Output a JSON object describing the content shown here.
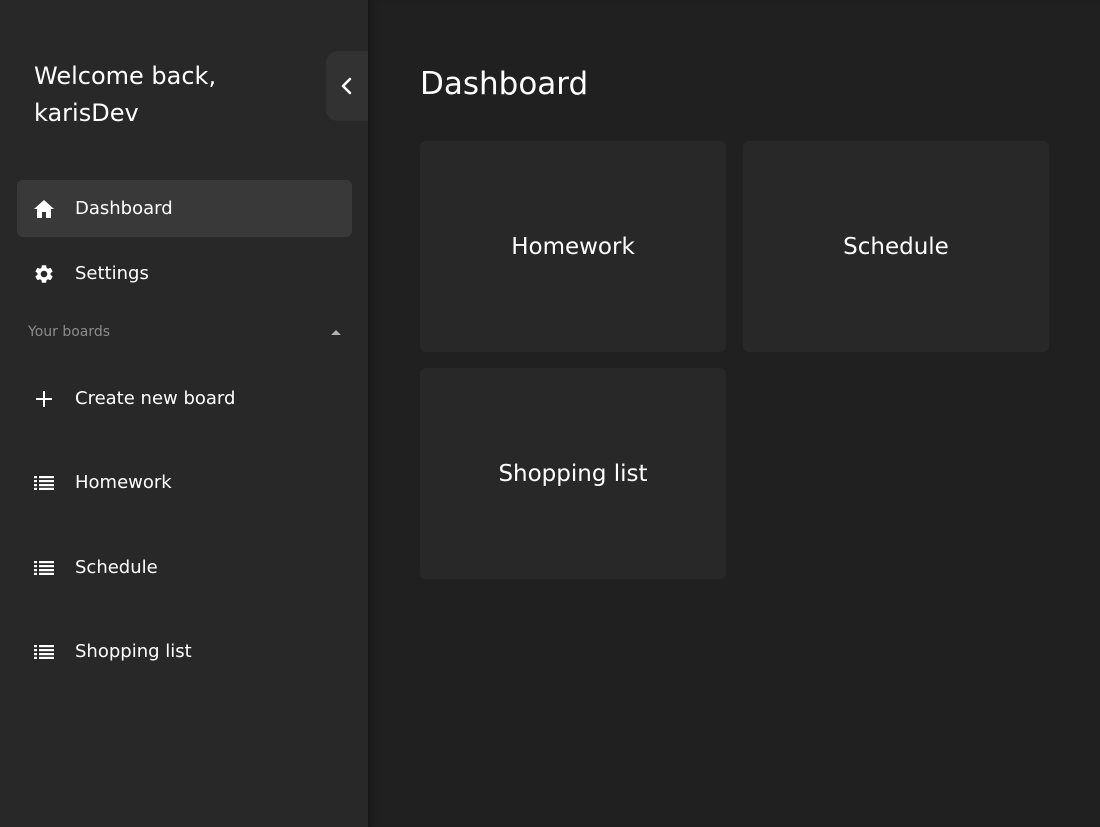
{
  "sidebar": {
    "welcome_line1": "Welcome back,",
    "welcome_line2": "karisDev",
    "collapse_icon": "chevron-left-icon",
    "nav": [
      {
        "label": "Dashboard",
        "icon": "home-icon",
        "active": true
      },
      {
        "label": "Settings",
        "icon": "gear-icon",
        "active": false
      }
    ],
    "boards_section": {
      "label": "Your boards",
      "icon": "caret-up-icon"
    },
    "create_board": {
      "label": "Create new board",
      "icon": "plus-icon"
    },
    "boards": [
      {
        "label": "Homework",
        "icon": "list-icon"
      },
      {
        "label": "Schedule",
        "icon": "list-icon"
      },
      {
        "label": "Shopping list",
        "icon": "list-icon"
      }
    ]
  },
  "main": {
    "title": "Dashboard",
    "cards": [
      {
        "label": "Homework"
      },
      {
        "label": "Schedule"
      },
      {
        "label": "Shopping list"
      }
    ]
  },
  "colors": {
    "sidebar_bg": "#282828",
    "main_bg": "#202020",
    "active_item_bg": "#393939",
    "card_bg": "#282828",
    "muted_text": "#8c8c8c"
  }
}
